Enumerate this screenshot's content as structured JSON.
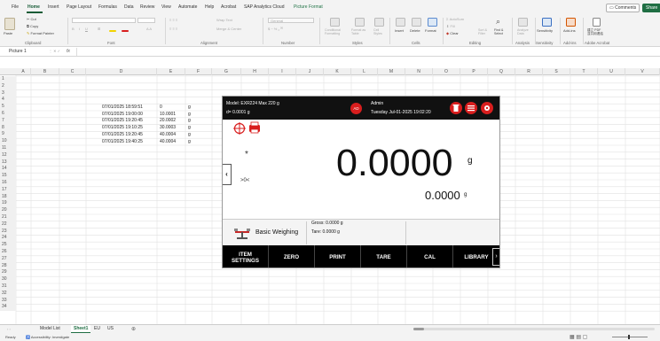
{
  "menu_tabs": [
    "File",
    "Home",
    "Insert",
    "Page Layout",
    "Formulas",
    "Data",
    "Review",
    "View",
    "Automate",
    "Help",
    "Acrobat",
    "SAP Analytics Cloud",
    "Picture Format"
  ],
  "comments_label": "Comments",
  "share_label": "Share",
  "ribbon": {
    "clipboard": {
      "paste": "Paste",
      "cut": "Cut",
      "copy": "Copy",
      "format_painter": "Format Painter",
      "label": "Clipboard"
    },
    "font": {
      "name": "",
      "size": "",
      "label": "Font"
    },
    "alignment": {
      "wrap": "Wrap Text",
      "merge": "Merge & Center",
      "label": "Alignment"
    },
    "number": {
      "format": "General",
      "label": "Number"
    },
    "styles": {
      "conditional": "Conditional\nFormatting",
      "format_table": "Format as\nTable",
      "cell_styles": "Cell\nStyles",
      "label": "Styles"
    },
    "cells": {
      "insert": "Insert",
      "delete": "Delete",
      "format": "Format",
      "label": "Cells"
    },
    "editing": {
      "autosum": "AutoSum",
      "fill": "Fill",
      "clear": "Clear",
      "sort": "Sort &\nFilter",
      "find": "Find &\nSelect",
      "label": "Editing"
    },
    "analysis": {
      "analyze": "Analyze\nData",
      "label": "Analysis"
    },
    "sensitivity": {
      "btn": "Sensitivity",
      "label": "Sensitivity"
    },
    "addins": {
      "btn": "Add-ins",
      "label": "Add-ins"
    },
    "adobe": {
      "btn": "建立 PDF\n並共用連結",
      "label": "Adobe Acrobat"
    }
  },
  "formula_bar": {
    "name_box": "Picture 1",
    "fx": "fx",
    "content": ""
  },
  "columns": [
    "A",
    "B",
    "C",
    "D",
    "E",
    "F",
    "G",
    "H",
    "I",
    "J",
    "K",
    "L",
    "M",
    "N",
    "O",
    "P",
    "Q",
    "R",
    "S",
    "T",
    "U",
    "V"
  ],
  "rows": [
    "1",
    "2",
    "3",
    "4",
    "5",
    "6",
    "7",
    "8",
    "9",
    "10",
    "11",
    "12",
    "13",
    "14",
    "15",
    "16",
    "17",
    "18",
    "19",
    "20",
    "21",
    "22",
    "23",
    "24",
    "25",
    "26",
    "27",
    "28",
    "29",
    "30",
    "31",
    "32",
    "33",
    "34"
  ],
  "table": [
    {
      "datetime": "07/01/2025 18:59:51",
      "value": "0",
      "unit": "g"
    },
    {
      "datetime": "07/01/2025 19:00:00",
      "value": "10.0001",
      "unit": "g"
    },
    {
      "datetime": "07/01/2025 19:20:45",
      "value": "20.0002",
      "unit": "g"
    },
    {
      "datetime": "07/01/2025 19:10:25",
      "value": "30.0003",
      "unit": "g"
    },
    {
      "datetime": "07/01/2025 19:20:45",
      "value": "40.0004",
      "unit": "g"
    },
    {
      "datetime": "07/01/2025 19:40:25",
      "value": "40.0004",
      "unit": "g"
    }
  ],
  "sheet_tabs": [
    "Model List",
    "Sheet1",
    "EU",
    "US"
  ],
  "status": {
    "ready": "Ready",
    "accessibility": "Accessibility: Investigate"
  },
  "balance": {
    "model": "Model: EXR224   Max 220 g",
    "readability": "d= 0.0001 g",
    "user_badge": "AD",
    "username": "Admin",
    "datetime": "Tuesday Jul-01-2025 19:02:20",
    "star": "*",
    "zero_indicator": ">0<",
    "main_value": "0.0000",
    "main_unit": "g",
    "sub_value": "0.0000",
    "sub_unit": "g",
    "mode": "Basic Weighing",
    "gross": "Gross: 0.0000 g",
    "tare": "Tare: 0.0000 g",
    "softkeys": [
      "ITEM\nSETTINGS",
      "ZERO",
      "PRINT",
      "TARE",
      "CAL",
      "LIBRARY"
    ],
    "colors": {
      "badge": "#d81e1e",
      "icon_red": "#d81e1e",
      "bar": "#000000"
    }
  }
}
